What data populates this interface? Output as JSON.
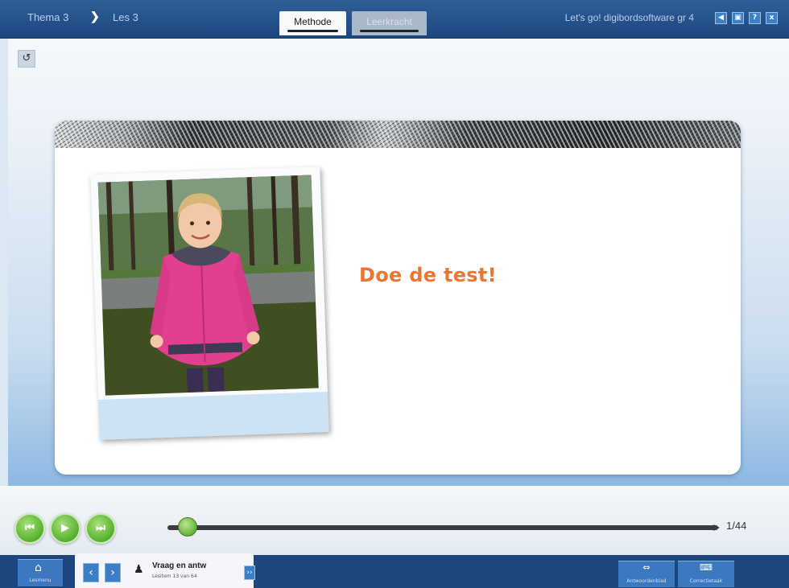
{
  "header": {
    "breadcrumb": {
      "thema": "Thema 3",
      "separator": "❯",
      "les": "Les 3"
    },
    "tabs": [
      {
        "label": "Methode",
        "active": true
      },
      {
        "label": "Leerkracht",
        "active": false
      }
    ],
    "app_title": "Let's go! digibordsoftware gr 4",
    "window_buttons": [
      "◀",
      "▣",
      "?",
      "x"
    ]
  },
  "slide": {
    "rotate_icon": "↺",
    "heading": "Doe de test!",
    "photo_icon": "photo-of-girl-in-pink-jacket"
  },
  "player": {
    "controls": {
      "previous": "⏮",
      "play": "▶",
      "next": "⏭"
    },
    "progress": {
      "current": 1,
      "total": 44,
      "label": "1/44"
    }
  },
  "bottom": {
    "home": {
      "icon": "⌂",
      "label": "Lesmenu"
    },
    "nav": {
      "prev": "‹",
      "next": "›"
    },
    "activity": {
      "icon": "♟",
      "title": "Vraag en antw",
      "subtitle": "Lesitem 13 van 64"
    },
    "expand": "››",
    "tools": [
      {
        "icon": "⇔",
        "label": "Antwoordenblad"
      },
      {
        "icon": "⌨",
        "label": "Correctietaak"
      }
    ]
  },
  "colors": {
    "topbar": "#1d467e",
    "accent_orange": "#ec7630",
    "button_green": "#55b02e",
    "button_blue": "#3c78c0"
  }
}
